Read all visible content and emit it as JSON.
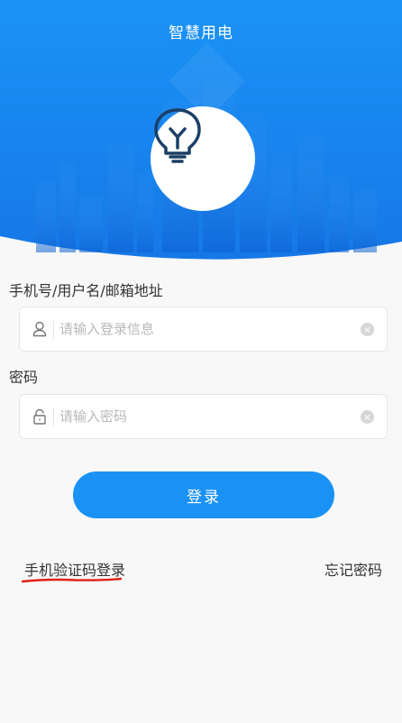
{
  "header": {
    "title": "智慧用电",
    "logo_icon": "lightbulb-icon",
    "gradient_top": "#1a8ff5",
    "gradient_bottom": "#1777e8"
  },
  "form": {
    "username": {
      "label": "手机号/用户名/邮箱地址",
      "placeholder": "请输入登录信息",
      "icon": "user-icon"
    },
    "password": {
      "label": "密码",
      "placeholder": "请输入密码",
      "icon": "lock-icon"
    },
    "login_label": "登录"
  },
  "links": {
    "sms_login": "手机验证码登录",
    "forgot_password": "忘记密码"
  },
  "colors": {
    "accent": "#1a92f5",
    "annotation_underline": "#e0201a"
  }
}
